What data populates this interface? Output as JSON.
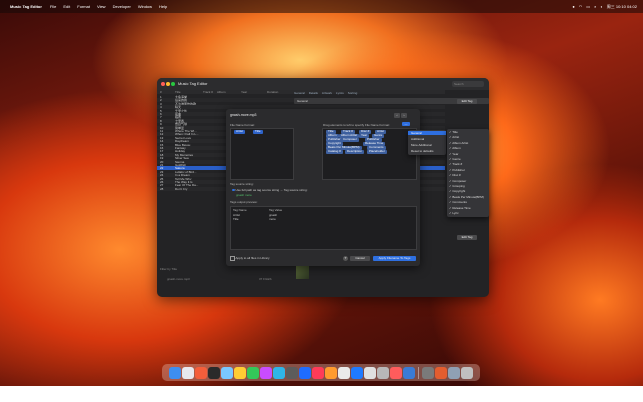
{
  "menubar": {
    "app_name": "Music Tag Editor",
    "items": [
      "File",
      "Edit",
      "Format",
      "View",
      "Developer",
      "Window",
      "Help"
    ],
    "clock": "周三 10:10 04:02"
  },
  "window": {
    "title": "Music Tag Editor",
    "search_placeholder": "Search",
    "columns": [
      "#",
      "Title",
      "Track #",
      "Album",
      "Year",
      "Duration"
    ],
    "rows": [
      {
        "title": "大鱼海棠",
        "track": "",
        "album": "",
        "year": "",
        "duration": ""
      },
      {
        "title": "后来的我",
        "track": "",
        "album": "",
        "year": "",
        "duration": ""
      },
      {
        "title": "不为谁而作的歌",
        "track": "",
        "album": "",
        "year": "",
        "duration": ""
      },
      {
        "title": "晴天",
        "track": "",
        "album": "",
        "year": "",
        "duration": ""
      },
      {
        "title": "千里之外",
        "track": "",
        "album": "",
        "year": "",
        "duration": ""
      },
      {
        "title": "夜曲",
        "track": "",
        "album": "",
        "year": "",
        "duration": ""
      },
      {
        "title": "稻香",
        "track": "",
        "album": "",
        "year": "",
        "duration": ""
      },
      {
        "title": "七里香",
        "track": "",
        "album": "",
        "year": "",
        "duration": ""
      },
      {
        "title": "告白气球",
        "track": "",
        "album": "",
        "year": "",
        "duration": ""
      },
      {
        "title": "简单爱",
        "track": "",
        "album": "",
        "year": "",
        "duration": ""
      },
      {
        "title": "Where The Wi...",
        "track": "",
        "album": "",
        "year": "",
        "duration": ""
      },
      {
        "title": "When I Fall In L...",
        "track": "",
        "album": "",
        "year": "",
        "duration": ""
      },
      {
        "title": "Secret Love",
        "track": "",
        "album": "",
        "year": "",
        "duration": ""
      },
      {
        "title": "Daydream",
        "track": "",
        "album": "",
        "year": "",
        "duration": ""
      },
      {
        "title": "Blue Bayou",
        "track": "",
        "album": "",
        "year": "",
        "duration": ""
      },
      {
        "title": "Fantasy",
        "track": "",
        "album": "",
        "year": "",
        "duration": ""
      },
      {
        "title": "Holiday",
        "track": "",
        "album": "",
        "year": "",
        "duration": ""
      },
      {
        "title": "My Memories",
        "track": "",
        "album": "",
        "year": "",
        "duration": ""
      },
      {
        "title": "Silver Sea",
        "track": "",
        "album": "",
        "year": "",
        "duration": ""
      },
      {
        "title": "Sienna",
        "track": "",
        "album": "",
        "year": "",
        "duration": ""
      },
      {
        "title": "Goldfish",
        "track": "",
        "album": "",
        "year": "",
        "duration": ""
      },
      {
        "title": "Sakura",
        "track": "",
        "album": "",
        "year": "",
        "duration": ""
      },
      {
        "title": "Lullaby of Bird...",
        "track": "",
        "album": "",
        "year": "",
        "duration": ""
      },
      {
        "title": "In a Dream",
        "track": "",
        "album": "",
        "year": "",
        "duration": ""
      },
      {
        "title": "Tell Me Why",
        "track": "",
        "album": "",
        "year": "",
        "duration": ""
      },
      {
        "title": "The Way It Is",
        "track": "",
        "album": "",
        "year": "",
        "duration": ""
      },
      {
        "title": "Fear Of The Da...",
        "track": "",
        "album": "",
        "year": "",
        "duration": ""
      },
      {
        "title": "Don't Cry",
        "track": "",
        "album": "",
        "year": "",
        "duration": ""
      }
    ],
    "status_left": "Filter by Title",
    "status_file": "gnash-more.mp3",
    "status_count": "37 FILES",
    "tag_tabs": [
      "General",
      "Details",
      "Artwork",
      "Lyrics",
      "Sorting"
    ],
    "general_label": "General",
    "edit_tag_button": "Edit Tag"
  },
  "dialog": {
    "file_name": "gnash-more.mp3",
    "file_name_format_label": "File Name Format:",
    "format_chips": [
      "Artist",
      "Title"
    ],
    "drag_label": "Drag elements to left to specify File Name Format:",
    "element_chips": [
      "Title",
      "Track #",
      "Disc #",
      "Artist",
      "Album",
      "Album Artist",
      "Year",
      "Genre",
      "Publisher",
      "Composer",
      "Publisher",
      "Copyright",
      "Release Time",
      "Beats Per Minute(BPM)",
      "Comments",
      "Catalog #",
      "Description",
      "Placeholder"
    ],
    "tag_source_label": "Tag source string:",
    "use_full_path": "Use full path as tag source string → Tag source string:",
    "source_value": "gnash more",
    "tags_output_label": "Tags output preview:",
    "preview_headers": [
      "Tag Name",
      "Tag Value"
    ],
    "preview_rows": [
      {
        "name": "Artist",
        "value": "gnash"
      },
      {
        "name": "Title",
        "value": "more"
      }
    ],
    "apply_all": "Apply to all files in Library",
    "cancel": "Cancel",
    "apply": "Apply Filename To Tags"
  },
  "context_menu": {
    "items": [
      "General",
      "Additional",
      "More Additional",
      "Reset to defaults"
    ],
    "selected": "General"
  },
  "submenu": {
    "items": [
      "Title",
      "Artist",
      "Album Artist",
      "Album",
      "Year",
      "Genre",
      "Track #",
      "Publisher",
      "Disc #",
      "Composer",
      "Grouping",
      "Copyright",
      "Beats Per Minute(BPM)",
      "Comments",
      "Release Time",
      "Lyric"
    ]
  },
  "dock": {
    "colors": [
      "#3d8ef0",
      "#e8e8ee",
      "#f45e3b",
      "#2a2a2a",
      "#7ac7ff",
      "#ffcc33",
      "#34c759",
      "#c94cff",
      "#2fb5e8",
      "#5c5c5c",
      "#1e6cff",
      "#ff3b58",
      "#ff9a2e",
      "#eaeaea",
      "#1f7aff",
      "#e0e0e0",
      "#b8b8b8",
      "#ff5c5c",
      "#3a7bd5",
      "#7a7a7a",
      "#e35d2f",
      "#8fa0b4",
      "#c0c0c0"
    ]
  }
}
